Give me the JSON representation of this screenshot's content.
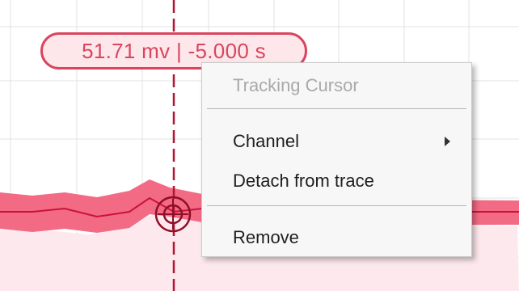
{
  "cursor_readout": {
    "voltage": "51.71 mv",
    "separator": "|",
    "time": "-5.000 s"
  },
  "context_menu": {
    "title": "Tracking Cursor",
    "items": [
      {
        "label": "Channel",
        "has_submenu": true
      },
      {
        "label": "Detach from trace",
        "has_submenu": false
      },
      {
        "label": "Remove",
        "has_submenu": false
      }
    ]
  },
  "colors": {
    "trace": "#e8375a",
    "trace_band": "#f4a0b0",
    "trace_fill": "#fde9ed",
    "grid": "#e3e3e3",
    "cursor_line": "#b01733",
    "readout_border": "#d9455f"
  },
  "icons": {
    "cursor_marker": "crosshair-target-icon",
    "submenu": "chevron-right-icon"
  }
}
